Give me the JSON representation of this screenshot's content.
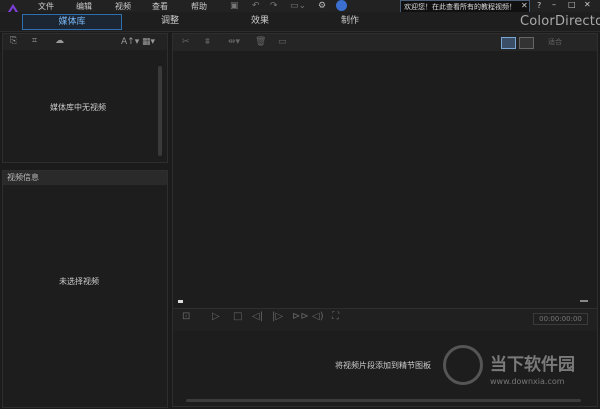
{
  "menu": [
    "文件",
    "编辑",
    "视频",
    "查看",
    "帮助"
  ],
  "notice": {
    "text": "欢迎您！在此查看所有的教程视频！",
    "close": "✕"
  },
  "help": "?",
  "tabs": [
    "媒体库",
    "调整",
    "效果",
    "制作"
  ],
  "brand": "ColorDirector",
  "media_panel": {
    "empty_text": "媒体库中无视频"
  },
  "info_panel": {
    "header": "视频信息",
    "empty_text": "未选择视频"
  },
  "preview": {
    "timecode": "00:00:00:00",
    "hint": "将视频片段添加到精节图板"
  },
  "view_select": "适合",
  "watermark": {
    "text": "当下软件园",
    "url": "www.downxia.com"
  },
  "colors": {
    "accent": "#2f6fb0",
    "logo": "#7b3fd6",
    "bg": "#1b1b1b"
  }
}
